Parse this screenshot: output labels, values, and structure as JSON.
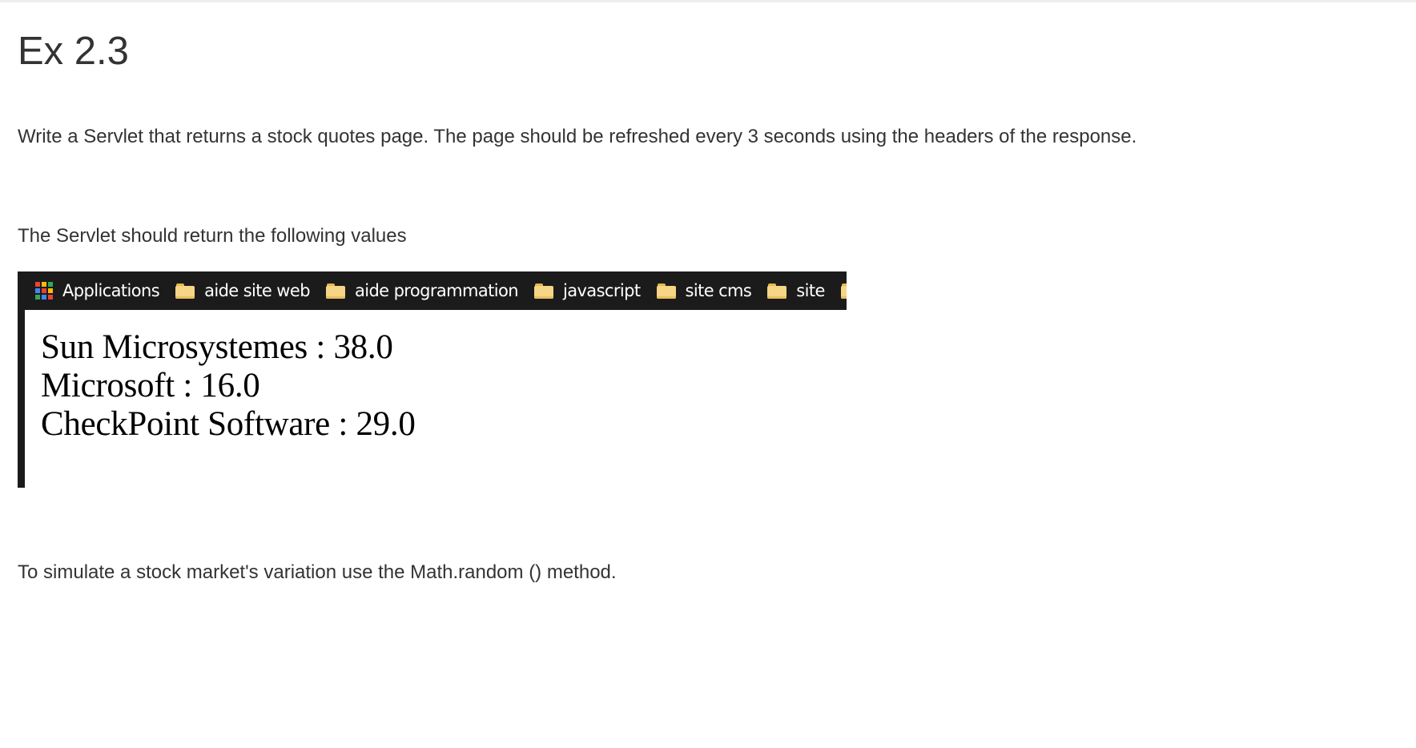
{
  "exercise": {
    "title": "Ex 2.3",
    "description": "Write a Servlet that returns a stock quotes page. The page should be refreshed every 3 seconds using the headers of the response.",
    "intro": "The Servlet should return the following values",
    "hint": "To simulate a stock market's variation use the Math.random () method."
  },
  "screenshot": {
    "bookmarks": [
      {
        "label": "Applications",
        "icon": "apps-grid-icon"
      },
      {
        "label": "aide site web",
        "icon": "folder-icon"
      },
      {
        "label": "aide programmation",
        "icon": "folder-icon"
      },
      {
        "label": "javascript",
        "icon": "folder-icon"
      },
      {
        "label": "site cms",
        "icon": "folder-icon"
      },
      {
        "label": "site",
        "icon": "folder-icon"
      }
    ],
    "quotes": [
      "Sun Microsystemes : 38.0",
      "Microsoft : 16.0",
      "CheckPoint Software : 29.0"
    ]
  },
  "colors": {
    "text": "#333333",
    "bookmark_bar": "#1b1b1b",
    "folder": "#f6d586",
    "apps_grid": [
      "#e94235",
      "#fbbc05",
      "#34a853",
      "#4285f4"
    ]
  }
}
